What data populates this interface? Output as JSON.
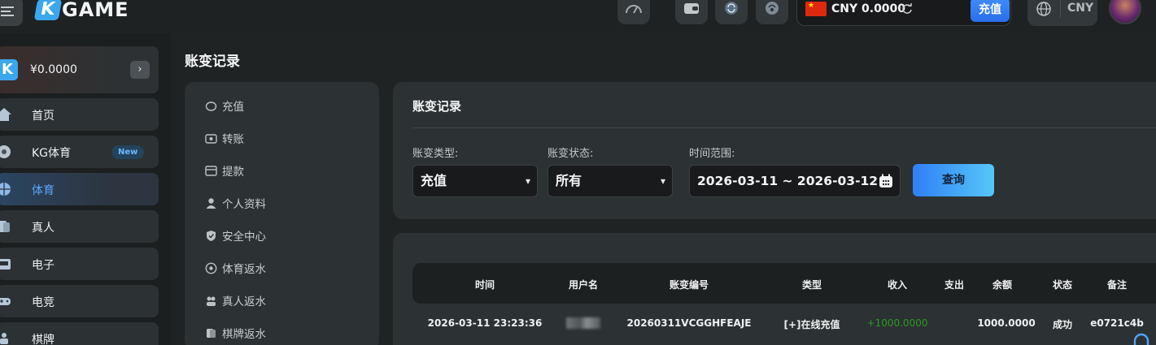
{
  "brand": {
    "logo_text": "GAME",
    "logo_mark": "K"
  },
  "header": {
    "wallet": {
      "flag_icon": "china-flag-icon",
      "balance": "CNY 0.0000",
      "recharge_label": "充值"
    },
    "language": {
      "currency": "CNY"
    }
  },
  "sidebar": {
    "balance": "¥0.0000",
    "items": [
      {
        "label": "首页",
        "icon": "home-icon"
      },
      {
        "label": "KG体育",
        "icon": "soccer-ball-icon",
        "badge": "New"
      },
      {
        "label": "体育",
        "icon": "basketball-icon",
        "active": true
      },
      {
        "label": "真人",
        "icon": "cards-icon"
      },
      {
        "label": "电子",
        "icon": "slot-machine-icon"
      },
      {
        "label": "电竞",
        "icon": "gamepad-icon"
      },
      {
        "label": "棋牌",
        "icon": "chess-icon"
      }
    ]
  },
  "page": {
    "title": "账变记录"
  },
  "subnav": {
    "items": [
      {
        "label": "充值",
        "icon": "piggy-bank-icon"
      },
      {
        "label": "转账",
        "icon": "transfer-icon"
      },
      {
        "label": "提款",
        "icon": "withdraw-icon"
      },
      {
        "label": "个人资料",
        "icon": "user-icon"
      },
      {
        "label": "安全中心",
        "icon": "shield-icon"
      },
      {
        "label": "体育返水",
        "icon": "soccer-ball-icon"
      },
      {
        "label": "真人返水",
        "icon": "people-icon"
      },
      {
        "label": "棋牌返水",
        "icon": "cards-icon"
      }
    ]
  },
  "filters": {
    "title": "账变记录",
    "type_label": "账变类型:",
    "type_value": "充值",
    "status_label": "账变状态:",
    "status_value": "所有",
    "range_label": "时间范围:",
    "range_value": "2026-03-11 ~ 2026-03-12",
    "query_label": "查询"
  },
  "table": {
    "headers": [
      "时间",
      "用户名",
      "账变编号",
      "类型",
      "收入",
      "支出",
      "余额",
      "状态",
      "备注"
    ],
    "rows": [
      {
        "time": "2026-03-11 23:23:36",
        "username": "",
        "id": "20260311VCGGHFEAJE",
        "type": "[+]在线充值",
        "income": "+1000.0000",
        "expense": "",
        "balance": "1000.0000",
        "status": "成功",
        "remark": "e0721c4b"
      }
    ]
  },
  "colors": {
    "accent": "#3f8dff",
    "income": "#2a9a22",
    "active_nav": "#5aa7ff"
  }
}
